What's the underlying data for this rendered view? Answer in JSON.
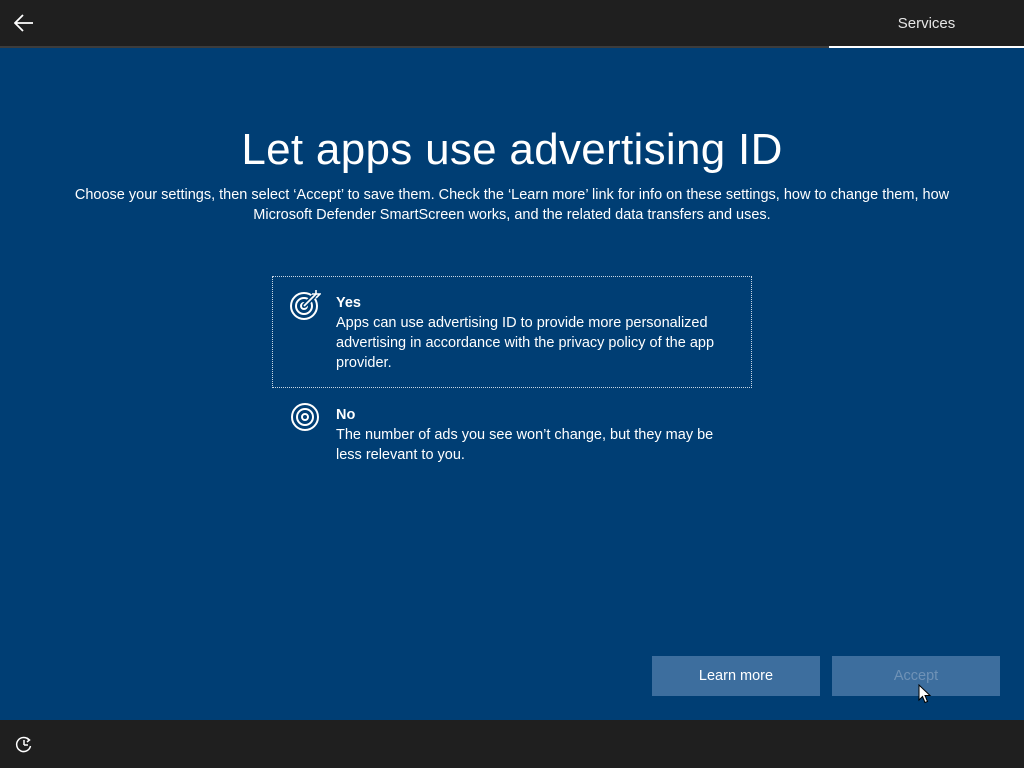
{
  "header": {
    "back_icon": "arrow-left-icon",
    "section_label": "Services"
  },
  "main": {
    "title": "Let apps use advertising ID",
    "description": "Choose your settings, then select ‘Accept’ to save them. Check the ‘Learn more’ link for info on these settings, how to change them, how Microsoft Defender SmartScreen works, and the related data transfers and uses."
  },
  "options": [
    {
      "icon": "target-arrow-icon",
      "title": "Yes",
      "description": "Apps can use advertising ID to provide more personalized advertising in accordance with the privacy policy of the app provider.",
      "selected": true
    },
    {
      "icon": "target-icon",
      "title": "No",
      "description": "The number of ads you see won’t change, but they may be less relevant to you.",
      "selected": false
    }
  ],
  "buttons": {
    "learn_more": "Learn more",
    "accept": "Accept"
  },
  "footer": {
    "ease_of_access_icon": "ease-of-access-icon"
  },
  "colors": {
    "background": "#003e74",
    "bar": "#1f1f1f",
    "button": "#3d6e9e"
  }
}
